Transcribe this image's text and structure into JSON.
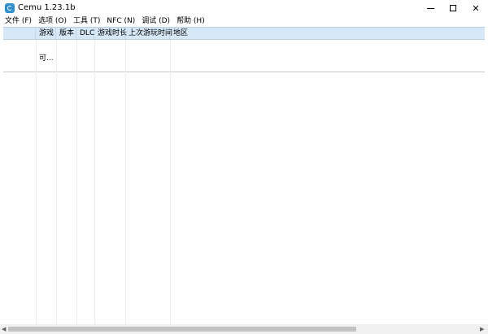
{
  "window": {
    "title": "Cemu 1.23.1b",
    "minimize": "—",
    "maximize": "☐",
    "close": "✕"
  },
  "menu": [
    {
      "label": "文件 (F)"
    },
    {
      "label": "选项 (O)"
    },
    {
      "label": "工具 (T)"
    },
    {
      "label": "NFC (N)"
    },
    {
      "label": "调试 (D)"
    },
    {
      "label": "帮助 (H)"
    }
  ],
  "columns": [
    {
      "label": ""
    },
    {
      "label": "游戏"
    },
    {
      "label": "版本"
    },
    {
      "label": "DLC"
    },
    {
      "label": "游戏时长"
    },
    {
      "label": "上次游玩时间"
    },
    {
      "label": "地区"
    }
  ],
  "rows": [
    {
      "game": "可..."
    }
  ],
  "scrollbar": {
    "left_arrow": "◀",
    "right_arrow": "▶"
  }
}
